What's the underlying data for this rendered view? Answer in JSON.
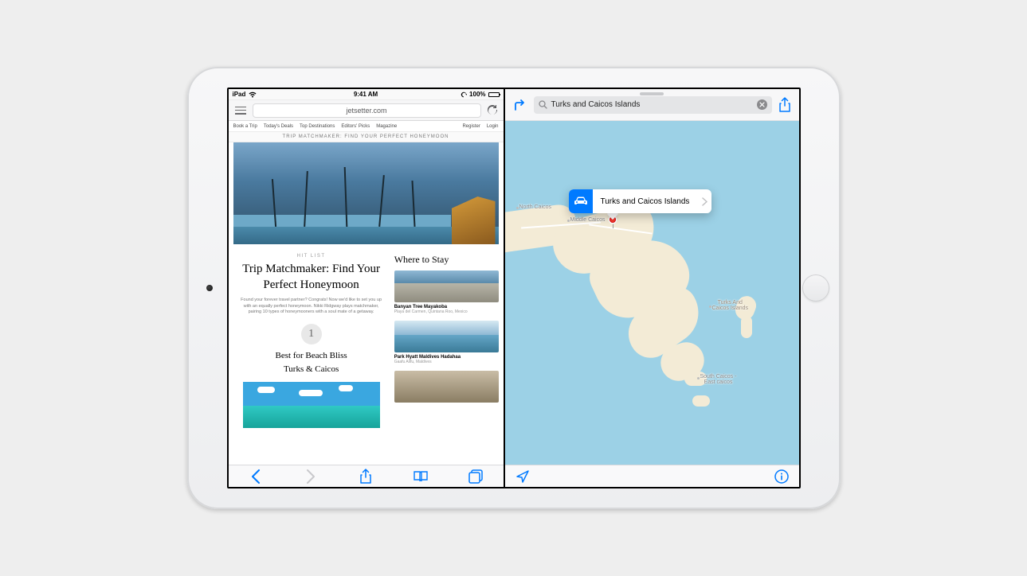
{
  "statusbar": {
    "carrier": "iPad",
    "time": "9:41 AM",
    "battery_pct": "100%"
  },
  "safari": {
    "url": "jetsetter.com",
    "nav": {
      "book": "Book a Trip",
      "deals": "Today's Deals",
      "top": "Top Destinations",
      "picks": "Editors' Picks",
      "magazine": "Magazine",
      "register": "Register",
      "login": "Login"
    },
    "banner": "TRIP MATCHMAKER: FIND YOUR PERFECT HONEYMOON",
    "article": {
      "hit_label": "HIT LIST",
      "headline": "Trip Matchmaker: Find Your Perfect Honeymoon",
      "lede": "Found your forever travel partner? Congrats! Now we'd like to set you up with an equally perfect honeymoon. Nikki Ridgway plays matchmaker, pairing 10 types of honeymooners with a soul mate of a getaway.",
      "number": "1",
      "subhead_line1": "Best for Beach Bliss",
      "subhead_line2": "Turks & Caicos"
    },
    "sidebar": {
      "heading": "Where to Stay",
      "cards": [
        {
          "title": "Banyan Tree Mayakoba",
          "sub": "Playa del Carmen, Quintana Roo, Mexico"
        },
        {
          "title": "Park Hyatt Maldives Hadahaa",
          "sub": "Gaafu Alifu, Maldives"
        },
        {
          "title": "",
          "sub": ""
        }
      ]
    }
  },
  "maps": {
    "search_value": "Turks and Caicos Islands",
    "callout_title": "Turks and Caicos Islands",
    "labels": {
      "north_caicos": "North Caicos",
      "middle_caicos": "Middle Caicos",
      "turks_and": "Turks And\nCaicos Islands",
      "south": "South Caicos -\nEast caicos"
    }
  },
  "colors": {
    "ios_blue": "#007aff",
    "map_water": "#9cd1e6",
    "map_land": "#f3ebd6"
  }
}
